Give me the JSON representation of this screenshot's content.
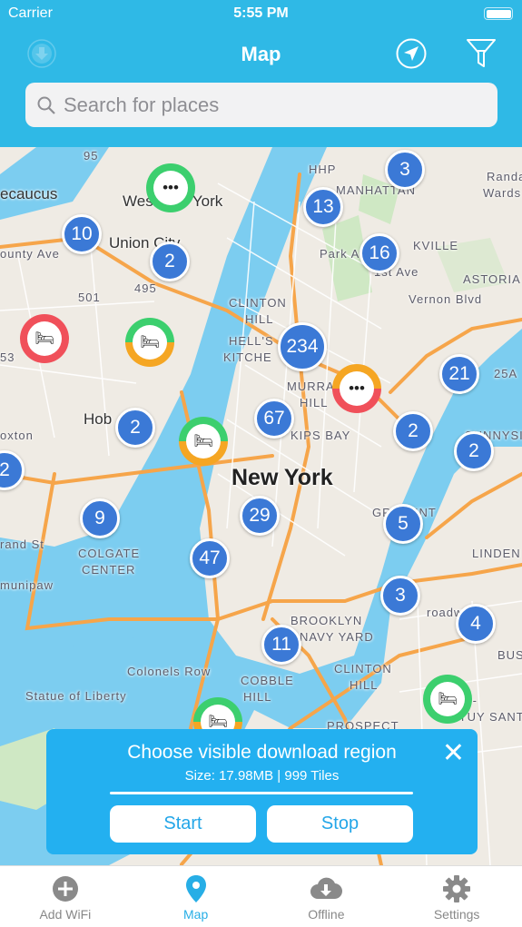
{
  "status_bar": {
    "carrier": "Carrier",
    "time": "5:55 PM"
  },
  "header": {
    "title": "Map",
    "download_icon": "download-circle-icon",
    "location_icon": "location-arrow-icon",
    "filter_icon": "funnel-icon"
  },
  "search": {
    "placeholder": "Search for places",
    "value": ""
  },
  "colors": {
    "accent": "#2fb9e6",
    "cluster": "#3b79d6",
    "green": "#3ccf6e",
    "orange": "#f5a623",
    "red": "#f0505a"
  },
  "map": {
    "labels": [
      "ecaucus",
      "Wes   New York",
      "Union City",
      "MANHATTAN",
      "CLINTON",
      "HILL",
      "HELL'S",
      "KITCHE",
      "MURRA",
      "HILL",
      "KIPS BAY",
      "New York",
      "Hob",
      "COLGATE",
      "CENTER",
      "Colonels Row",
      "Statue of Liberty",
      "BROOKLYN",
      "NAVY YARD",
      "COBBLE",
      "HILL",
      "CLINTON",
      "HILL",
      "ASTORIA",
      "SUNNYSIDE",
      "GR   POINT",
      "LINDEN",
      "BUS",
      "B   D-",
      "STUY   SANT",
      "PROSPECT",
      "Park Ave",
      "1st Ave",
      "Vernon Blvd",
      "Randa",
      "Wards",
      "oxton",
      "rand St",
      "munipaw",
      "roadway",
      "ounty Ave",
      "HHP",
      "495",
      "501",
      "95",
      "25A",
      "53",
      "KVILLE"
    ],
    "clusters": [
      "3",
      "13",
      "10",
      "2",
      "16",
      "234",
      "21",
      "67",
      "2",
      "2",
      "2",
      "2",
      "29",
      "9",
      "5",
      "47",
      "3",
      "4",
      "11"
    ],
    "markers": [
      {
        "type": "more",
        "ring": "green"
      },
      {
        "type": "hotel",
        "ring": "red"
      },
      {
        "type": "hotel",
        "ring": "orange-green"
      },
      {
        "type": "hotel",
        "ring": "orange-green"
      },
      {
        "type": "more",
        "ring": "red-orange"
      },
      {
        "type": "hotel",
        "ring": "green"
      },
      {
        "type": "hotel",
        "ring": "orange-green"
      }
    ]
  },
  "download_panel": {
    "title": "Choose visible download region",
    "subtitle": "Size: 17.98MB | 999 Tiles",
    "progress": 1.0,
    "start_label": "Start",
    "stop_label": "Stop"
  },
  "tabs": [
    {
      "label": "Add WiFi",
      "icon": "plus-circle-icon",
      "active": false
    },
    {
      "label": "Map",
      "icon": "map-pin-icon",
      "active": true
    },
    {
      "label": "Offline",
      "icon": "cloud-download-icon",
      "active": false
    },
    {
      "label": "Settings",
      "icon": "gear-icon",
      "active": false
    }
  ]
}
